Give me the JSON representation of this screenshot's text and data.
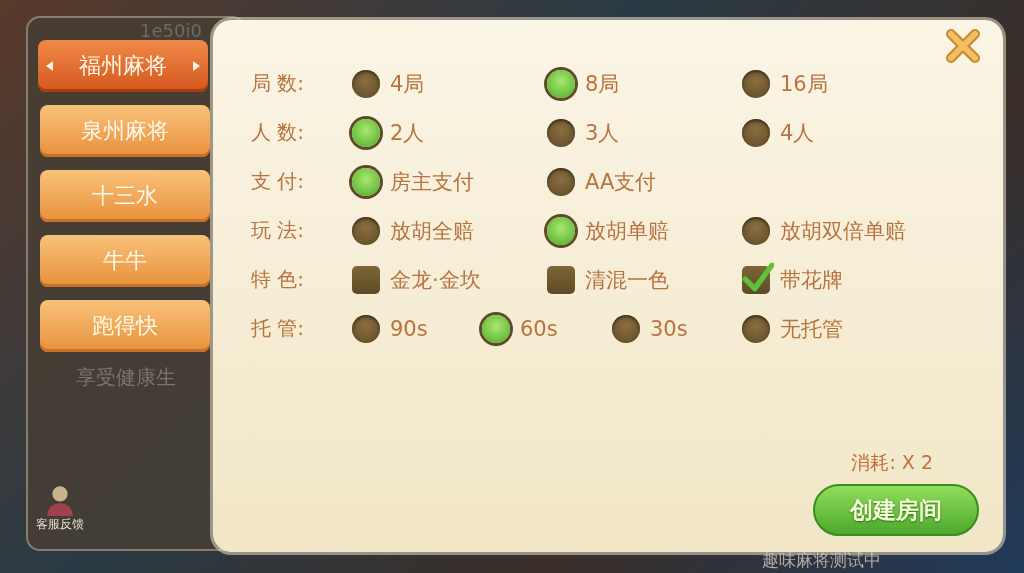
{
  "background": {
    "top_text": "1e50i0",
    "notice_text": "享受健康生",
    "support_label": "客服反馈",
    "bottom_text": "趣味麻将测试中"
  },
  "game_tabs": [
    {
      "label": "福州麻将",
      "selected": true
    },
    {
      "label": "泉州麻将",
      "selected": false
    },
    {
      "label": "十三水",
      "selected": false
    },
    {
      "label": "牛牛",
      "selected": false
    },
    {
      "label": "跑得快",
      "selected": false
    }
  ],
  "options": [
    {
      "label": "局 数:",
      "kind": "radio",
      "choices": [
        {
          "label": "4局",
          "selected": false
        },
        {
          "label": "8局",
          "selected": true
        },
        {
          "label": "16局",
          "selected": false
        }
      ]
    },
    {
      "label": "人 数:",
      "kind": "radio",
      "choices": [
        {
          "label": "2人",
          "selected": true
        },
        {
          "label": "3人",
          "selected": false
        },
        {
          "label": "4人",
          "selected": false
        }
      ]
    },
    {
      "label": "支 付:",
      "kind": "radio",
      "choices": [
        {
          "label": "房主支付",
          "selected": true
        },
        {
          "label": "AA支付",
          "selected": false
        }
      ]
    },
    {
      "label": "玩 法:",
      "kind": "radio",
      "choices": [
        {
          "label": "放胡全赔",
          "selected": false
        },
        {
          "label": "放胡单赔",
          "selected": true
        },
        {
          "label": "放胡双倍单赔",
          "selected": false
        }
      ]
    },
    {
      "label": "特 色:",
      "kind": "checkbox",
      "choices": [
        {
          "label": "金龙·金坎",
          "checked": false
        },
        {
          "label": "清混一色",
          "checked": false
        },
        {
          "label": "带花牌",
          "checked": true
        }
      ]
    },
    {
      "label": "托 管:",
      "kind": "radio",
      "choices": [
        {
          "label": "90s",
          "selected": false
        },
        {
          "label": "60s",
          "selected": true
        },
        {
          "label": "30s",
          "selected": false
        },
        {
          "label": "无托管",
          "selected": false
        }
      ]
    }
  ],
  "cost": "消耗: X 2",
  "create_button": "创建房间"
}
